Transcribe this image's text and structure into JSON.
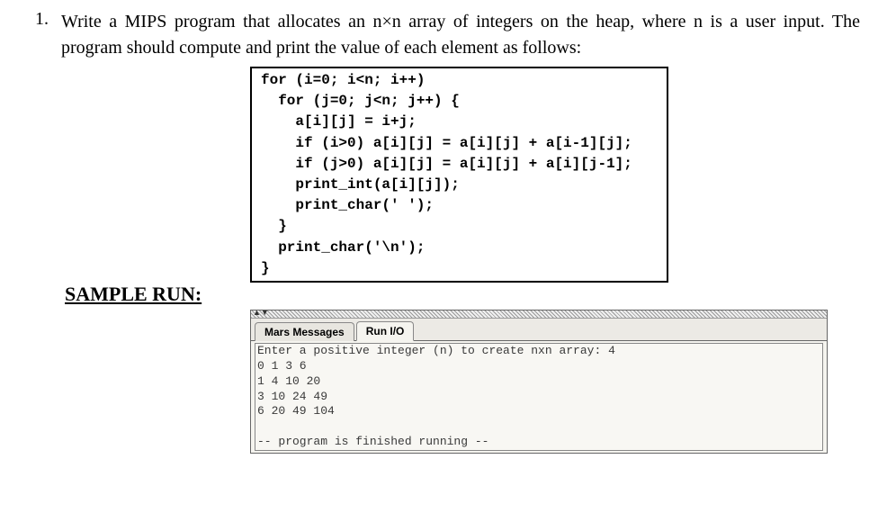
{
  "question": {
    "number": "1.",
    "text": "Write a MIPS program that allocates an n×n array of integers on the heap, where n is a user input. The program should compute and print the value of each element as follows:"
  },
  "code": "for (i=0; i<n; i++)\n  for (j=0; j<n; j++) {\n    a[i][j] = i+j;\n    if (i>0) a[i][j] = a[i][j] + a[i-1][j];\n    if (j>0) a[i][j] = a[i][j] + a[i][j-1];\n    print_int(a[i][j]);\n    print_char(' ');\n  }\n  print_char('\\n');\n}",
  "sample_run_label": "SAMPLE RUN:",
  "ide": {
    "tabs": {
      "messages": "Mars Messages",
      "runio": "Run I/O"
    },
    "console_output": "Enter a positive integer (n) to create nxn array: 4\n0 1 3 6\n1 4 10 20\n3 10 24 49\n6 20 49 104\n\n-- program is finished running --"
  },
  "chart_data": {
    "type": "table",
    "title": "nxn array values (n=4)",
    "rows": [
      [
        0,
        1,
        3,
        6
      ],
      [
        1,
        4,
        10,
        20
      ],
      [
        3,
        10,
        24,
        49
      ],
      [
        6,
        20,
        49,
        104
      ]
    ]
  }
}
